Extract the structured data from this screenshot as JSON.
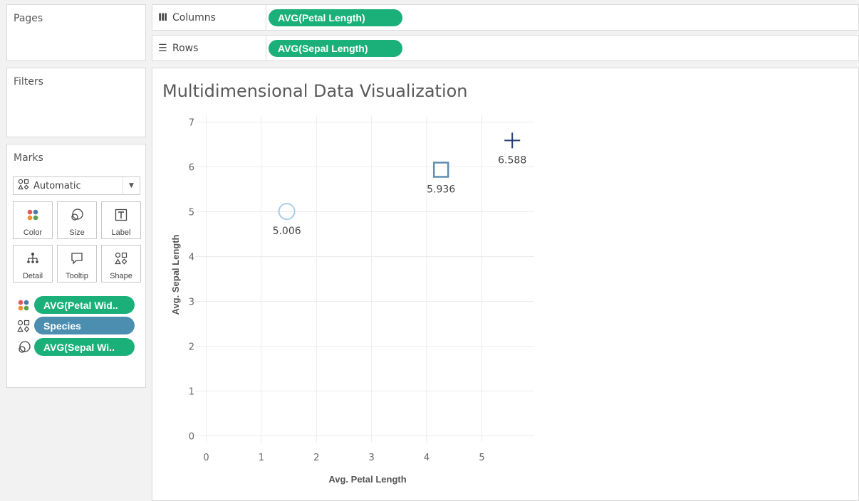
{
  "panels": {
    "pages_title": "Pages",
    "filters_title": "Filters",
    "marks_title": "Marks"
  },
  "marks": {
    "mark_type": "Automatic",
    "buttons": [
      {
        "label": "Color",
        "icon": "color-dots-icon"
      },
      {
        "label": "Size",
        "icon": "size-icon"
      },
      {
        "label": "Label",
        "icon": "label-icon"
      },
      {
        "label": "Detail",
        "icon": "detail-icon"
      },
      {
        "label": "Tooltip",
        "icon": "tooltip-icon"
      },
      {
        "label": "Shape",
        "icon": "shape-icon"
      }
    ],
    "pills": [
      {
        "icon": "color-dots-icon",
        "label": "AVG(Petal Wid..",
        "color": "#1bb07a"
      },
      {
        "icon": "shape-icon",
        "label": "Species",
        "color": "#4c8eb0"
      },
      {
        "icon": "size-icon",
        "label": "AVG(Sepal Wi..",
        "color": "#1bb07a"
      }
    ]
  },
  "shelves": {
    "columns_label": "Columns",
    "columns_pill": "AVG(Petal Length)",
    "rows_label": "Rows",
    "rows_pill": "AVG(Sepal Length)"
  },
  "colors": {
    "pill_green": "#1bb07a",
    "pill_blue": "#4c8eb0",
    "circle_mark": "#a9cde6",
    "square_mark": "#5f8db4",
    "cross_mark": "#1f3f73"
  },
  "chart_data": {
    "type": "scatter",
    "title": "Multidimensional Data Visualization",
    "xlabel": "Avg. Petal Length",
    "ylabel": "Avg. Sepal Length",
    "xlim": [
      -0.2,
      5.95
    ],
    "ylim": [
      -0.15,
      7.15
    ],
    "xticks": [
      0,
      1,
      2,
      3,
      4,
      5
    ],
    "yticks": [
      0,
      1,
      2,
      3,
      4,
      5,
      6,
      7
    ],
    "grid": true,
    "points": [
      {
        "x": 1.462,
        "y": 5.006,
        "label": "5.006",
        "shape": "circle"
      },
      {
        "x": 4.26,
        "y": 5.936,
        "label": "5.936",
        "shape": "square"
      },
      {
        "x": 5.552,
        "y": 6.588,
        "label": "6.588",
        "shape": "cross"
      }
    ]
  }
}
